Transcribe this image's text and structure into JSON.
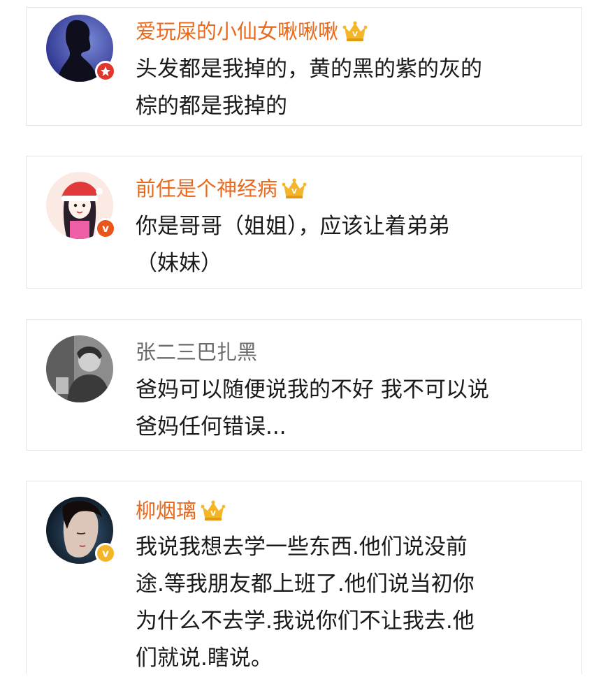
{
  "colors": {
    "vip_name": "#e9691d",
    "normal_name": "#6b6b6b",
    "comment_text": "#1a1a1a",
    "card_border": "#e6e6e6",
    "crown": "#f4b528",
    "badge_red": "#e0362c",
    "badge_orange": "#e8551d",
    "badge_gold": "#f4b528"
  },
  "comments": [
    {
      "username": "爱玩屎的小仙女啾啾啾",
      "vip": true,
      "badge": "red-star-badge",
      "text": "头发都是我掉的，黄的黑的紫的灰的\n棕的都是我掉的"
    },
    {
      "username": "前任是个神经病",
      "vip": true,
      "badge": "orange-v-badge",
      "text": "你是哥哥（姐姐），应该让着弟弟\n（妹妹）"
    },
    {
      "username": "张二三巴扎黑",
      "vip": false,
      "badge": "",
      "text": "爸妈可以随便说我的不好 我不可以说\n爸妈任何错误..."
    },
    {
      "username": "柳烟璃",
      "vip": true,
      "badge": "gold-v-badge",
      "text": "我说我想去学一些东西.他们说没前\n途.等我朋友都上班了.他们说当初你\n为什么不去学.我说你们不让我去.他\n们就说.瞎说。"
    }
  ]
}
